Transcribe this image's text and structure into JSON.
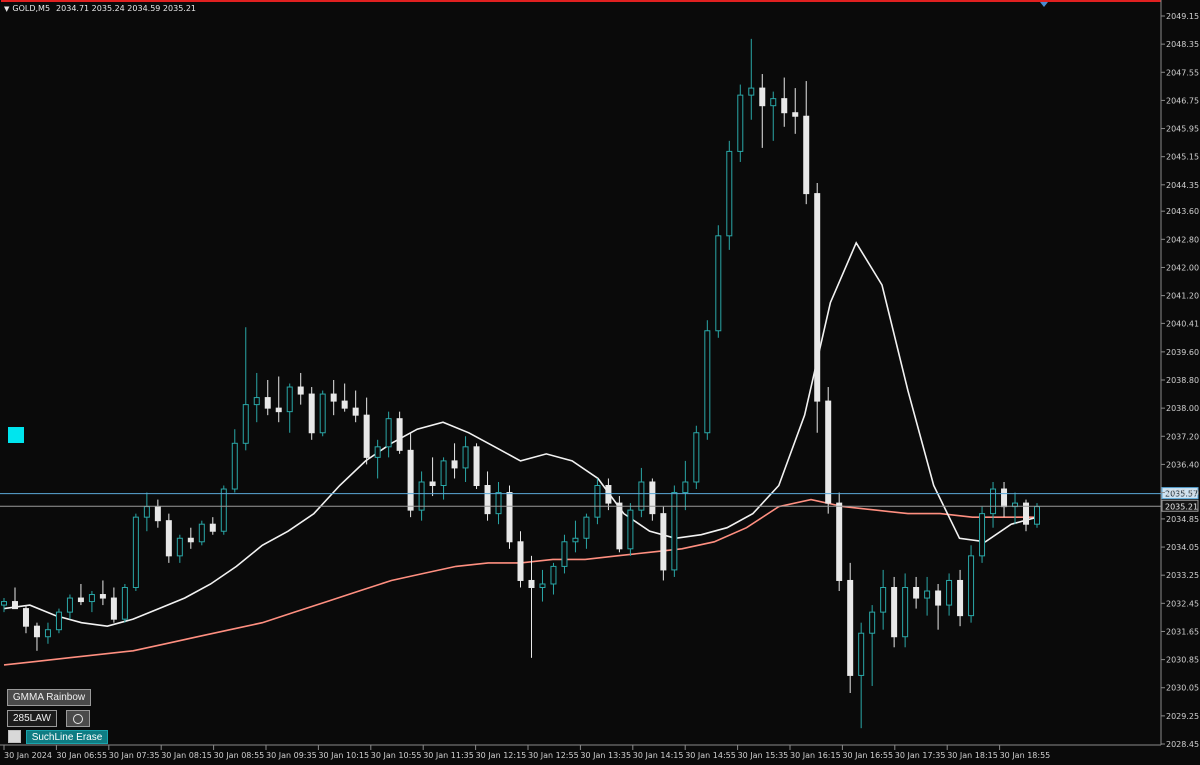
{
  "header": {
    "symbol": "GOLD,M5",
    "ohlc": "2034.71 2035.24 2034.59 2035.21"
  },
  "buttons": {
    "gmma": "GMMA Rainbow",
    "law": "285LAW",
    "erase": "SuchLine Erase"
  },
  "colors": {
    "background": "#0a0a0a",
    "bull": "#2aa7a7",
    "bear": "#e8e8e8",
    "fast_ma": "#f2f2f2",
    "slow_ma": "#ff8f80",
    "top_line": "#e02020",
    "cyan_marker": "#00e5ee"
  },
  "chart_data": {
    "type": "candlestick",
    "symbol": "GOLD",
    "timeframe": "M5",
    "ylim": [
      2028.45,
      2049.15
    ],
    "y_ticks": [
      "2049.15",
      "2048.35",
      "2047.55",
      "2046.75",
      "2045.95",
      "2045.15",
      "2044.35",
      "2043.60",
      "2042.80",
      "2042.00",
      "2041.20",
      "2040.41",
      "2039.60",
      "2038.80",
      "2038.00",
      "2037.20",
      "2036.40",
      "2035.60",
      "2034.85",
      "2034.05",
      "2033.25",
      "2032.45",
      "2031.65",
      "2030.85",
      "2030.05",
      "2029.25",
      "2028.45"
    ],
    "x_ticks": [
      "30 Jan 2024",
      "30 Jan 06:55",
      "30 Jan 07:35",
      "30 Jan 08:15",
      "30 Jan 08:55",
      "30 Jan 09:35",
      "30 Jan 10:15",
      "30 Jan 10:55",
      "30 Jan 11:35",
      "30 Jan 12:15",
      "30 Jan 12:55",
      "30 Jan 13:35",
      "30 Jan 14:15",
      "30 Jan 14:55",
      "30 Jan 15:35",
      "30 Jan 16:15",
      "30 Jan 16:55",
      "30 Jan 17:35",
      "30 Jan 18:15",
      "30 Jan 18:55"
    ],
    "price_labels": [
      {
        "value": 2035.57,
        "label": "2035.57",
        "style": "highlight"
      },
      {
        "value": 2035.21,
        "label": "2035.21",
        "style": "bid"
      }
    ],
    "ma_fast": [
      2032.3,
      2032.4,
      2032.1,
      2031.9,
      2031.8,
      2032.0,
      2032.3,
      2032.6,
      2033.0,
      2033.5,
      2034.1,
      2034.5,
      2035.0,
      2035.8,
      2036.5,
      2037.0,
      2037.4,
      2037.6,
      2037.3,
      2036.9,
      2036.5,
      2036.7,
      2036.5,
      2036.0,
      2035.0,
      2034.5,
      2034.3,
      2034.4,
      2034.6,
      2035.0,
      2035.8,
      2037.8,
      2041.0,
      2042.7,
      2041.5,
      2038.5,
      2035.8,
      2034.3,
      2034.2,
      2034.7,
      2034.9
    ],
    "ma_slow": [
      2030.7,
      2030.8,
      2030.9,
      2031.0,
      2031.1,
      2031.3,
      2031.5,
      2031.7,
      2031.9,
      2032.2,
      2032.5,
      2032.8,
      2033.1,
      2033.3,
      2033.5,
      2033.6,
      2033.6,
      2033.7,
      2033.7,
      2033.8,
      2033.9,
      2034.0,
      2034.2,
      2034.6,
      2035.2,
      2035.4,
      2035.2,
      2035.1,
      2035.0,
      2035.0,
      2034.9,
      2034.9,
      2034.9
    ],
    "candles": [
      [
        2032.4,
        2032.6,
        2032.2,
        2032.5
      ],
      [
        2032.5,
        2032.9,
        2032.3,
        2032.3
      ],
      [
        2032.3,
        2032.4,
        2031.6,
        2031.8
      ],
      [
        2031.8,
        2031.9,
        2031.1,
        2031.5
      ],
      [
        2031.5,
        2031.9,
        2031.3,
        2031.7
      ],
      [
        2031.7,
        2032.3,
        2031.6,
        2032.2
      ],
      [
        2032.2,
        2032.7,
        2032.0,
        2032.6
      ],
      [
        2032.6,
        2033.0,
        2032.4,
        2032.5
      ],
      [
        2032.5,
        2032.8,
        2032.2,
        2032.7
      ],
      [
        2032.7,
        2033.1,
        2032.4,
        2032.6
      ],
      [
        2032.6,
        2032.9,
        2031.9,
        2032.0
      ],
      [
        2032.0,
        2033.0,
        2031.9,
        2032.9
      ],
      [
        2032.9,
        2035.0,
        2032.8,
        2034.9
      ],
      [
        2034.9,
        2035.6,
        2034.5,
        2035.2
      ],
      [
        2035.2,
        2035.4,
        2034.6,
        2034.8
      ],
      [
        2034.8,
        2035.0,
        2033.6,
        2033.8
      ],
      [
        2033.8,
        2034.4,
        2033.6,
        2034.3
      ],
      [
        2034.3,
        2034.6,
        2034.0,
        2034.2
      ],
      [
        2034.2,
        2034.8,
        2034.1,
        2034.7
      ],
      [
        2034.7,
        2034.9,
        2034.4,
        2034.5
      ],
      [
        2034.5,
        2035.8,
        2034.4,
        2035.7
      ],
      [
        2035.7,
        2037.4,
        2035.6,
        2037.0
      ],
      [
        2037.0,
        2040.3,
        2036.8,
        2038.1
      ],
      [
        2038.1,
        2039.0,
        2037.6,
        2038.3
      ],
      [
        2038.3,
        2038.8,
        2037.8,
        2038.0
      ],
      [
        2038.0,
        2038.9,
        2037.6,
        2037.9
      ],
      [
        2037.9,
        2038.7,
        2037.3,
        2038.6
      ],
      [
        2038.6,
        2039.0,
        2038.1,
        2038.4
      ],
      [
        2038.4,
        2038.6,
        2037.1,
        2037.3
      ],
      [
        2037.3,
        2038.5,
        2037.2,
        2038.4
      ],
      [
        2038.4,
        2038.8,
        2037.8,
        2038.2
      ],
      [
        2038.2,
        2038.7,
        2037.9,
        2038.0
      ],
      [
        2038.0,
        2038.5,
        2037.6,
        2037.8
      ],
      [
        2037.8,
        2038.3,
        2036.4,
        2036.6
      ],
      [
        2036.6,
        2037.1,
        2036.0,
        2036.9
      ],
      [
        2036.9,
        2037.9,
        2036.6,
        2037.7
      ],
      [
        2037.7,
        2037.9,
        2036.7,
        2036.8
      ],
      [
        2036.8,
        2037.3,
        2034.9,
        2035.1
      ],
      [
        2035.1,
        2036.2,
        2034.8,
        2035.9
      ],
      [
        2035.9,
        2036.6,
        2035.5,
        2035.8
      ],
      [
        2035.8,
        2036.6,
        2035.4,
        2036.5
      ],
      [
        2036.5,
        2037.0,
        2036.0,
        2036.3
      ],
      [
        2036.3,
        2037.2,
        2035.9,
        2036.9
      ],
      [
        2036.9,
        2037.0,
        2035.7,
        2035.8
      ],
      [
        2035.8,
        2036.2,
        2034.8,
        2035.0
      ],
      [
        2035.0,
        2035.9,
        2034.7,
        2035.6
      ],
      [
        2035.6,
        2035.8,
        2034.0,
        2034.2
      ],
      [
        2034.2,
        2034.5,
        2032.9,
        2033.1
      ],
      [
        2033.1,
        2033.8,
        2030.9,
        2032.9
      ],
      [
        2032.9,
        2033.4,
        2032.5,
        2033.0
      ],
      [
        2033.0,
        2033.6,
        2032.7,
        2033.5
      ],
      [
        2033.5,
        2034.4,
        2033.3,
        2034.2
      ],
      [
        2034.2,
        2034.8,
        2033.9,
        2034.3
      ],
      [
        2034.3,
        2035.0,
        2034.0,
        2034.9
      ],
      [
        2034.9,
        2036.0,
        2034.7,
        2035.8
      ],
      [
        2035.8,
        2036.0,
        2035.1,
        2035.3
      ],
      [
        2035.3,
        2035.5,
        2033.9,
        2034.0
      ],
      [
        2034.0,
        2035.3,
        2033.8,
        2035.1
      ],
      [
        2035.1,
        2036.3,
        2034.9,
        2035.9
      ],
      [
        2035.9,
        2036.0,
        2034.8,
        2035.0
      ],
      [
        2035.0,
        2035.2,
        2033.1,
        2033.4
      ],
      [
        2033.4,
        2035.8,
        2033.2,
        2035.6
      ],
      [
        2035.6,
        2036.5,
        2035.1,
        2035.9
      ],
      [
        2035.9,
        2037.5,
        2035.7,
        2037.3
      ],
      [
        2037.3,
        2040.5,
        2037.1,
        2040.2
      ],
      [
        2040.2,
        2043.2,
        2040.0,
        2042.9
      ],
      [
        2042.9,
        2045.6,
        2042.5,
        2045.3
      ],
      [
        2045.3,
        2047.2,
        2045.0,
        2046.9
      ],
      [
        2046.9,
        2048.5,
        2046.2,
        2047.1
      ],
      [
        2047.1,
        2047.5,
        2045.4,
        2046.6
      ],
      [
        2046.6,
        2047.0,
        2045.6,
        2046.8
      ],
      [
        2046.8,
        2047.4,
        2046.0,
        2046.4
      ],
      [
        2046.4,
        2047.1,
        2045.8,
        2046.3
      ],
      [
        2046.3,
        2047.3,
        2043.8,
        2044.1
      ],
      [
        2044.1,
        2044.4,
        2037.3,
        2038.2
      ],
      [
        2038.2,
        2038.6,
        2035.0,
        2035.3
      ],
      [
        2035.3,
        2035.6,
        2032.8,
        2033.1
      ],
      [
        2033.1,
        2033.6,
        2029.9,
        2030.4
      ],
      [
        2030.4,
        2031.9,
        2028.9,
        2031.6
      ],
      [
        2031.6,
        2032.4,
        2030.1,
        2032.2
      ],
      [
        2032.2,
        2033.4,
        2031.7,
        2032.9
      ],
      [
        2032.9,
        2033.2,
        2031.2,
        2031.5
      ],
      [
        2031.5,
        2033.3,
        2031.2,
        2032.9
      ],
      [
        2032.9,
        2033.2,
        2032.3,
        2032.6
      ],
      [
        2032.6,
        2033.2,
        2032.1,
        2032.8
      ],
      [
        2032.8,
        2033.0,
        2031.7,
        2032.4
      ],
      [
        2032.4,
        2033.3,
        2032.1,
        2033.1
      ],
      [
        2033.1,
        2033.4,
        2031.8,
        2032.1
      ],
      [
        2032.1,
        2034.1,
        2031.9,
        2033.8
      ],
      [
        2033.8,
        2035.2,
        2033.6,
        2035.0
      ],
      [
        2035.0,
        2035.9,
        2034.6,
        2035.7
      ],
      [
        2035.7,
        2035.9,
        2034.9,
        2035.2
      ],
      [
        2035.2,
        2035.6,
        2034.7,
        2035.3
      ],
      [
        2035.3,
        2035.4,
        2034.5,
        2034.7
      ],
      [
        2034.7,
        2035.3,
        2034.6,
        2035.2
      ]
    ]
  }
}
